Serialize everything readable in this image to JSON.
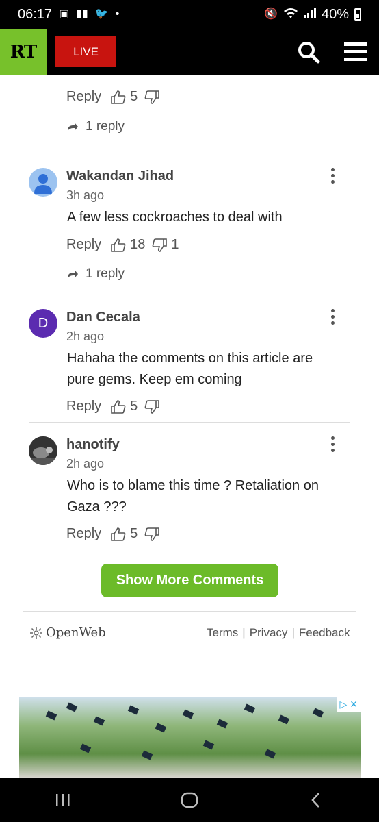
{
  "status_bar": {
    "time": "06:17",
    "battery": "40%"
  },
  "header": {
    "logo": "RT",
    "live_label": "LIVE"
  },
  "top_partial": {
    "reply_label": "Reply",
    "likes": "5",
    "replies_label": "1 reply"
  },
  "comments": [
    {
      "name": "Wakandan Jihad",
      "time": "3h ago",
      "text": "A few less cockroaches to deal with",
      "reply_label": "Reply",
      "likes": "18",
      "dislikes": "1",
      "replies_label": "1 reply"
    },
    {
      "name": "Dan Cecala",
      "avatar_letter": "D",
      "time": "2h ago",
      "text": "Hahaha the comments on this article are pure gems. Keep em coming",
      "reply_label": "Reply",
      "likes": "5"
    },
    {
      "name": "hanotify",
      "time": "2h ago",
      "text": "Who is to blame this time ?  Retaliation on Gaza ???",
      "reply_label": "Reply",
      "likes": "5"
    }
  ],
  "show_more_label": "Show More Comments",
  "footer": {
    "brand": "OpenWeb",
    "links": [
      "Terms",
      "Privacy",
      "Feedback"
    ]
  },
  "colors": {
    "rt_green": "#77c12b",
    "live_red": "#c8140f",
    "show_more_green": "#6cbb29",
    "avatar_purple": "#5b2bb0"
  }
}
